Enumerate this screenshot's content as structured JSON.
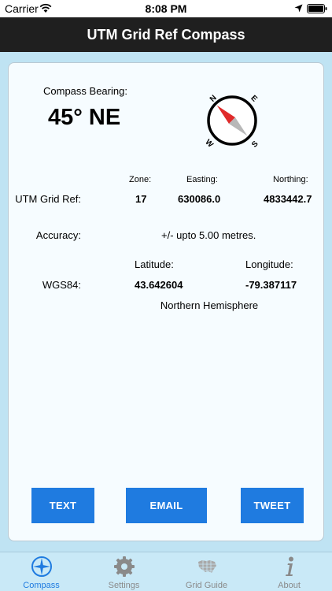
{
  "status_bar": {
    "carrier": "Carrier",
    "time": "8:08 PM"
  },
  "nav": {
    "title": "UTM Grid Ref Compass"
  },
  "compass": {
    "bearing_label": "Compass Bearing:",
    "bearing_value": "45° NE",
    "letters": {
      "n": "N",
      "e": "E",
      "s": "S",
      "w": "W"
    }
  },
  "utm": {
    "label": "UTM Grid Ref:",
    "zone_header": "Zone:",
    "easting_header": "Easting:",
    "northing_header": "Northing:",
    "zone": "17",
    "easting": "630086.0",
    "northing": "4833442.7"
  },
  "accuracy": {
    "label": "Accuracy:",
    "value": "+/- upto 5.00 metres."
  },
  "wgs84": {
    "label": "WGS84:",
    "latitude_header": "Latitude:",
    "longitude_header": "Longitude:",
    "latitude": "43.642604",
    "longitude": "-79.387117",
    "hemisphere": "Northern Hemisphere"
  },
  "actions": {
    "text_label": "TEXT",
    "email_label": "EMAIL",
    "tweet_label": "TWEET"
  },
  "tabs": [
    {
      "label": "Compass",
      "icon": "compass-icon",
      "active": true
    },
    {
      "label": "Settings",
      "icon": "gear-icon",
      "active": false
    },
    {
      "label": "Grid Guide",
      "icon": "map-icon",
      "active": false
    },
    {
      "label": "About",
      "icon": "info-icon",
      "active": false
    }
  ],
  "colors": {
    "accent": "#1f7be0",
    "nav_background": "#1f1f1f",
    "page_background": "#bfe3f3",
    "needle_north": "#e02a2a",
    "needle_south": "#b8b8b8"
  }
}
